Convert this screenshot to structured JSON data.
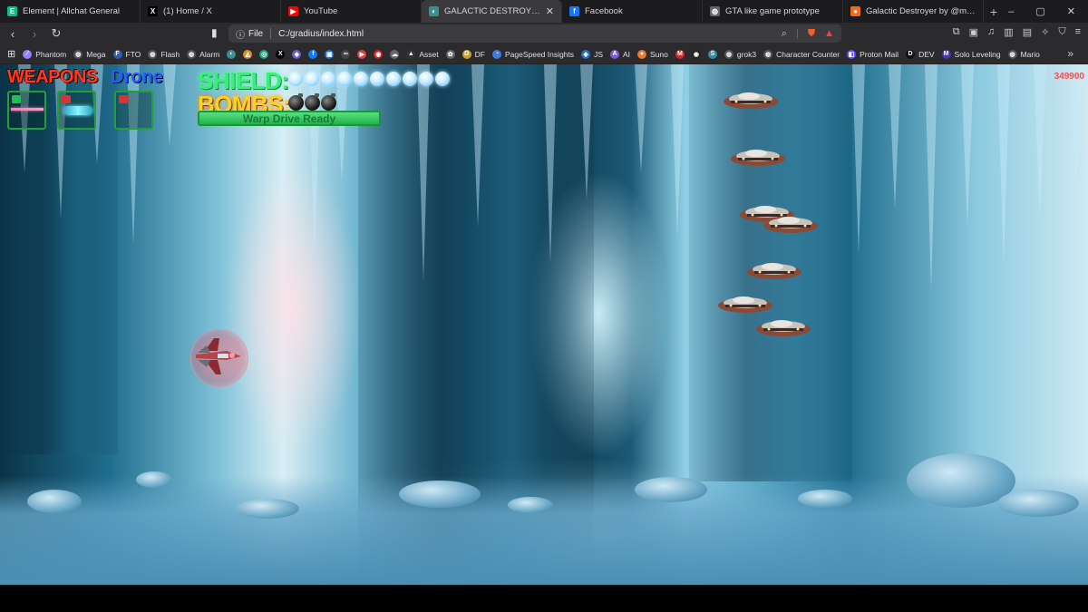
{
  "browser": {
    "tabs": [
      {
        "title": "Element | Allchat General",
        "icon": "element-icon",
        "color": "#0dbd8b",
        "glyph": "E",
        "active": false
      },
      {
        "title": "(1) Home / X",
        "icon": "x-icon",
        "color": "#000000",
        "glyph": "X",
        "active": false
      },
      {
        "title": "YouTube",
        "icon": "youtube-icon",
        "color": "#ff0000",
        "glyph": "▶",
        "active": false
      },
      {
        "title": "GALACTIC DESTROYER",
        "icon": "game-icon",
        "color": "#3a8f8f",
        "glyph": "◐",
        "active": true
      },
      {
        "title": "Facebook",
        "icon": "facebook-icon",
        "color": "#1877f2",
        "glyph": "f",
        "active": false
      },
      {
        "title": "GTA like game prototype",
        "icon": "globe-icon",
        "color": "#666666",
        "glyph": "◍",
        "active": false
      },
      {
        "title": "Galactic Destroyer by @mercuri",
        "icon": "orange-dot-icon",
        "color": "#f06a1a",
        "glyph": "●",
        "active": false
      }
    ],
    "new_tab_label": "+",
    "window_controls": {
      "minimize": "–",
      "maximize": "▢",
      "close": "✕"
    },
    "address": {
      "scheme_label": "File",
      "url": "C:/gradius/index.html"
    },
    "bookmarks": [
      {
        "label": "Phantom",
        "color": "#9a7dff",
        "glyph": "⁄"
      },
      {
        "label": "Mega",
        "color": "#555555",
        "glyph": "◍"
      },
      {
        "label": "FTO",
        "color": "#2d5fa8",
        "glyph": "F"
      },
      {
        "label": "Flash",
        "color": "#555555",
        "glyph": "◍"
      },
      {
        "label": "Alarm",
        "color": "#555555",
        "glyph": "◍"
      },
      {
        "label": "",
        "color": "#3a8f8f",
        "glyph": "◐"
      },
      {
        "label": "",
        "color": "#d98f2a",
        "glyph": "◭"
      },
      {
        "label": "",
        "color": "#1aa37a",
        "glyph": "◎"
      },
      {
        "label": "",
        "color": "#000000",
        "glyph": "X"
      },
      {
        "label": "",
        "color": "#6a5acd",
        "glyph": "◆"
      },
      {
        "label": "",
        "color": "#1877f2",
        "glyph": "f"
      },
      {
        "label": "",
        "color": "#1f6fd1",
        "glyph": "▣"
      },
      {
        "label": "",
        "color": "#444444",
        "glyph": "∞"
      },
      {
        "label": "",
        "color": "#e23b3b",
        "glyph": "▶"
      },
      {
        "label": "",
        "color": "#d02020",
        "glyph": "◉"
      },
      {
        "label": "",
        "color": "#666666",
        "glyph": "☁"
      },
      {
        "label": "Asset",
        "color": "#333333",
        "glyph": "▲"
      },
      {
        "label": "",
        "color": "#666666",
        "glyph": "✿"
      },
      {
        "label": "DF",
        "color": "#c9a12a",
        "glyph": "D"
      },
      {
        "label": "PageSpeed Insights",
        "color": "#3d7be0",
        "glyph": "◔"
      },
      {
        "label": "JS",
        "color": "#1f6fd1",
        "glyph": "◆"
      },
      {
        "label": "AI",
        "color": "#7a5cd6",
        "glyph": "A"
      },
      {
        "label": "Suno",
        "color": "#e8772e",
        "glyph": "●"
      },
      {
        "label": "",
        "color": "#d22a2a",
        "glyph": "M"
      },
      {
        "label": "",
        "color": "#222222",
        "glyph": "◉"
      },
      {
        "label": "",
        "color": "#2a8fa5",
        "glyph": "S"
      },
      {
        "label": "grok3",
        "color": "#555555",
        "glyph": "◍"
      },
      {
        "label": "Character Counter",
        "color": "#555555",
        "glyph": "◍"
      },
      {
        "label": "Proton Mail",
        "color": "#6d4aff",
        "glyph": "◧"
      },
      {
        "label": "DEV",
        "color": "#111111",
        "glyph": "D"
      },
      {
        "label": "Solo Leveling",
        "color": "#4a3aa8",
        "glyph": "M"
      },
      {
        "label": "Mario",
        "color": "#555555",
        "glyph": "◍"
      }
    ]
  },
  "game": {
    "weapons_label": "WEAPONS",
    "drone_label": "Drone",
    "shield_label": "SHIELD:",
    "shield_level": 10,
    "bombs_label": "BOMBS:",
    "bomb_count": 3,
    "warp_label": "Warp Drive Ready",
    "warp_fill": 1.0,
    "score": "349900",
    "weapon_slots": [
      {
        "name": "laser-slot",
        "lock_color": "#1fc050",
        "content": "beam"
      },
      {
        "name": "plasma-slot",
        "lock_color": "#e03030",
        "content": "orbs"
      },
      {
        "name": "drone-slot",
        "lock_color": "#e03030",
        "content": "none"
      }
    ],
    "colors": {
      "weapons": "#ff3a1f",
      "drone": "#1f63ff",
      "shield": "#38f07a",
      "bombs": "#ffd21c",
      "warp": "#2fc45a",
      "score": "#ff4b4b"
    }
  }
}
